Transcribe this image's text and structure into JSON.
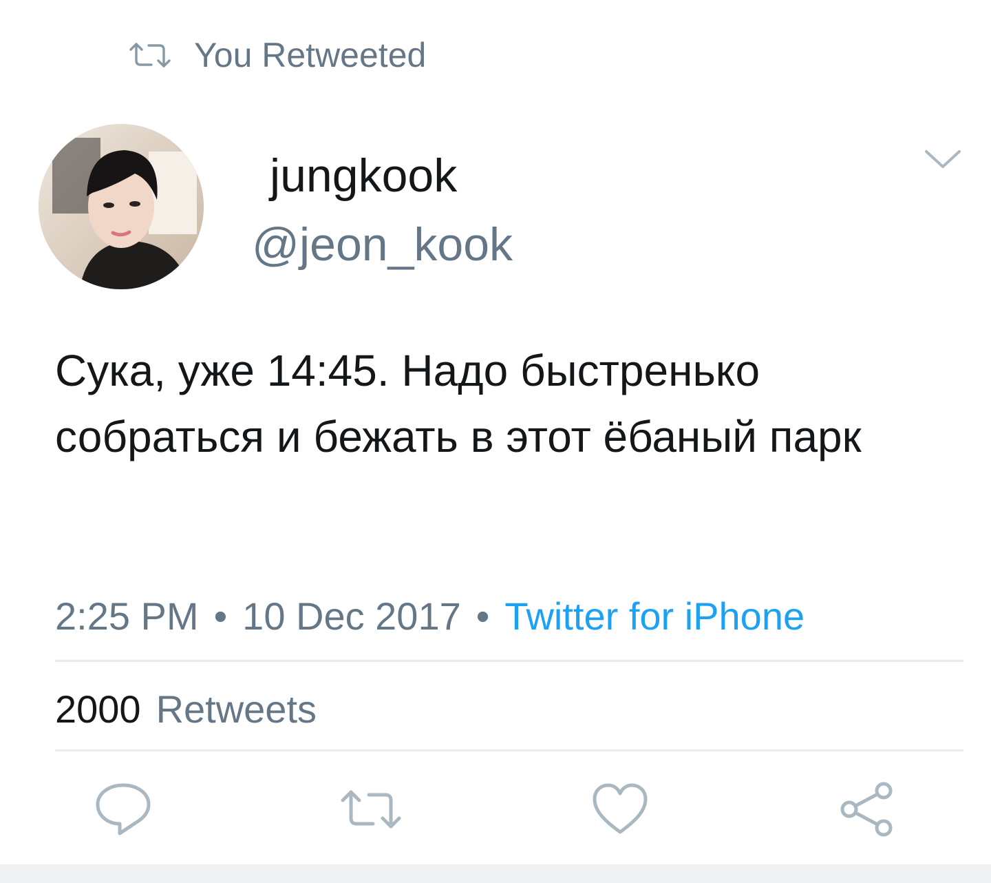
{
  "retweet_banner": {
    "icon": "retweet-icon",
    "text": "You Retweeted"
  },
  "author": {
    "display_name": "jungkook",
    "handle": "@jeon_kook"
  },
  "tweet": {
    "text": "Сука, уже 14:45. Надо быстренько собраться и бежать в этот ёбаный парк"
  },
  "meta": {
    "time": "2:25 PM",
    "date": "10 Dec 2017",
    "separator": "•",
    "source": "Twitter for iPhone"
  },
  "stats": {
    "retweet_count": "2000",
    "retweet_label": "Retweets"
  },
  "actions": {
    "reply_icon": "reply-icon",
    "retweet_icon": "retweet-icon",
    "like_icon": "heart-icon",
    "share_icon": "share-icon",
    "menu_icon": "chevron-down-icon"
  },
  "colors": {
    "text_primary": "#14171a",
    "text_secondary": "#657786",
    "link": "#1da1f2",
    "divider": "#e6ecf0"
  }
}
